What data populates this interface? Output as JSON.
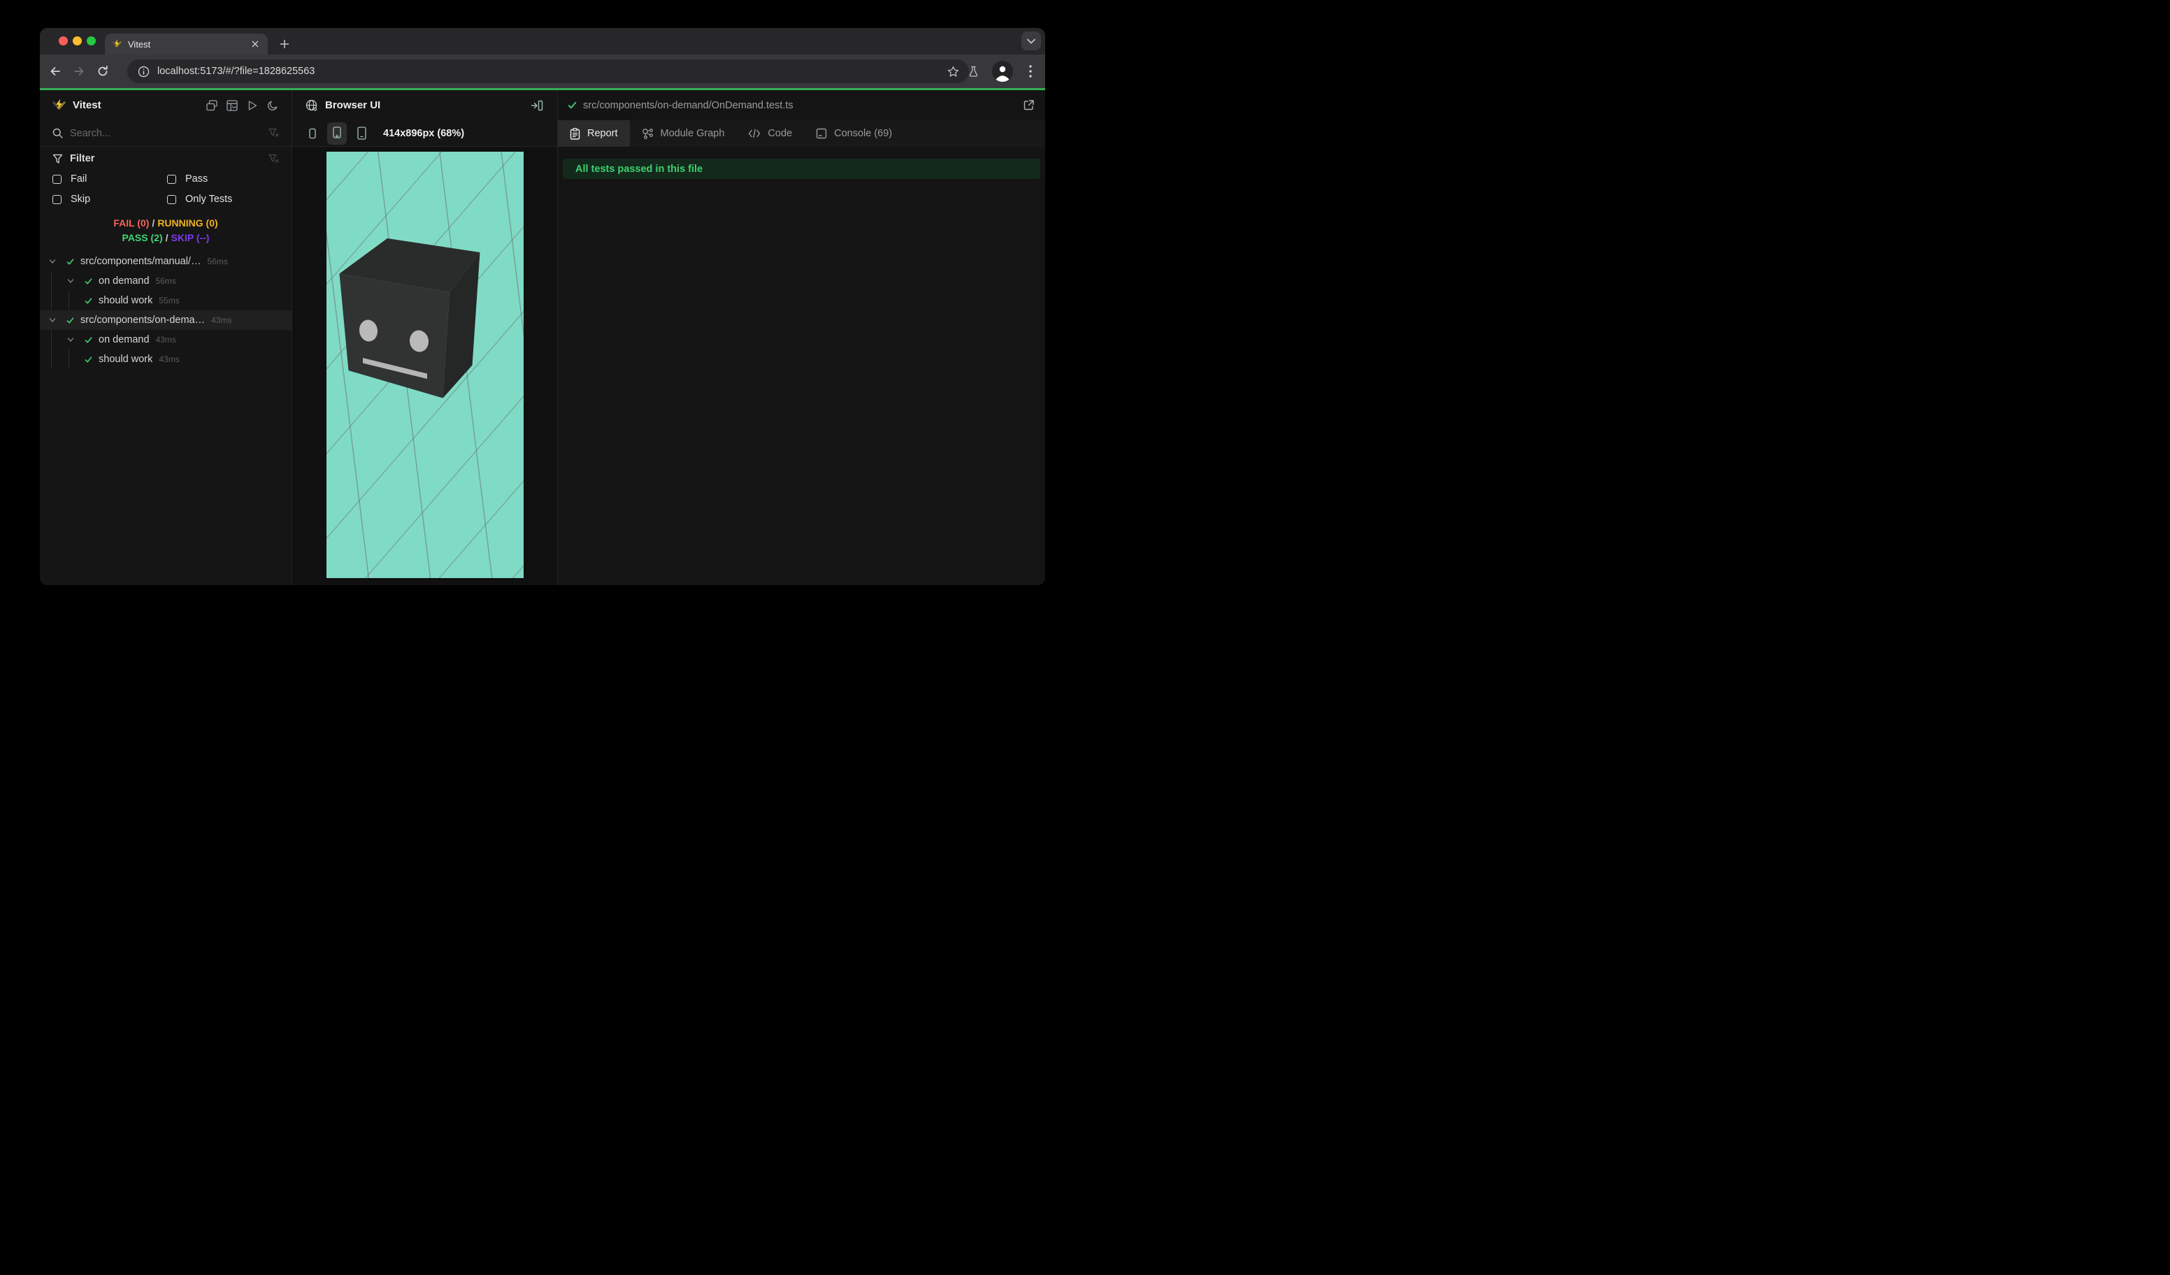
{
  "browser": {
    "tab_title": "Vitest",
    "url": "localhost:5173/#/?file=1828625563"
  },
  "sidebar": {
    "title": "Vitest",
    "search_placeholder": "Search...",
    "filter": {
      "label": "Filter",
      "options": [
        {
          "label": "Fail",
          "checked": false
        },
        {
          "label": "Pass",
          "checked": false
        },
        {
          "label": "Skip",
          "checked": false
        },
        {
          "label": "Only Tests",
          "checked": false
        }
      ]
    },
    "summary": {
      "fail": "FAIL (0)",
      "running": "RUNNING (0)",
      "pass": "PASS (2)",
      "skip": "SKIP (--)",
      "separator": "/"
    },
    "tree": [
      {
        "label": "src/components/manual/…",
        "duration": "56ms",
        "status": "pass",
        "level": 0
      },
      {
        "label": "on demand",
        "duration": "56ms",
        "status": "pass",
        "level": 1
      },
      {
        "label": "should work",
        "duration": "55ms",
        "status": "pass",
        "level": 2
      },
      {
        "label": "src/components/on-dema…",
        "duration": "43ms",
        "status": "pass",
        "level": 0,
        "selected": true
      },
      {
        "label": "on demand",
        "duration": "43ms",
        "status": "pass",
        "level": 1
      },
      {
        "label": "should work",
        "duration": "43ms",
        "status": "pass",
        "level": 2
      }
    ]
  },
  "preview": {
    "title": "Browser UI",
    "viewport_label": "414x896px (68%)"
  },
  "report": {
    "file_path": "src/components/on-demand/OnDemand.test.ts",
    "tabs": [
      {
        "label": "Report",
        "active": true
      },
      {
        "label": "Module Graph",
        "active": false
      },
      {
        "label": "Code",
        "active": false
      },
      {
        "label": "Console (69)",
        "active": false
      }
    ],
    "banner": "All tests passed in this file"
  },
  "colors": {
    "accent_green": "#35ae58",
    "preview_teal": "#80dbc6",
    "fail": "#f4645c",
    "running": "#eeb31f",
    "pass": "#41d375",
    "skip": "#7c3aed",
    "banner_bg": "#13291c",
    "banner_text": "#3ecf6e"
  }
}
